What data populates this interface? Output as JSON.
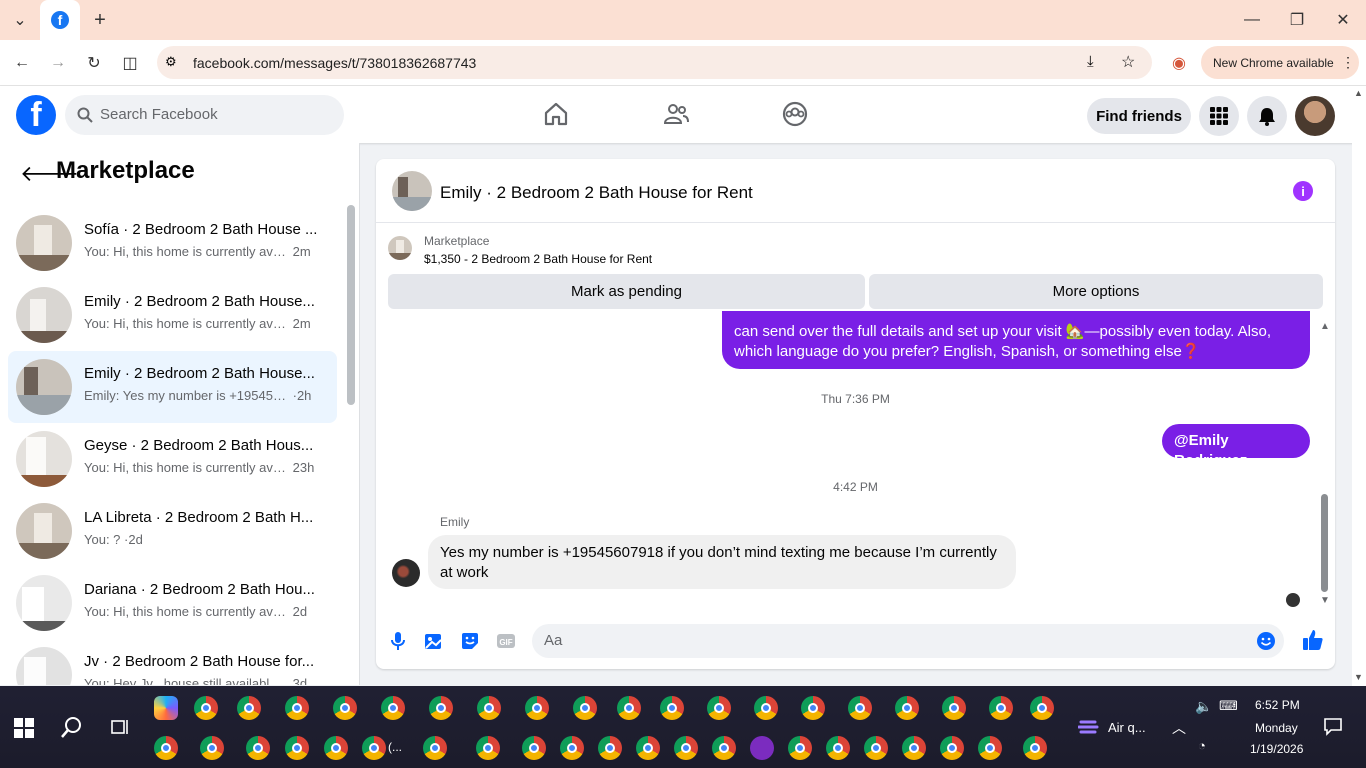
{
  "browser": {
    "url": "facebook.com/messages/t/738018362687743",
    "new_chrome_label": "New Chrome available"
  },
  "fb_header": {
    "search_placeholder": "Search Facebook",
    "find_friends_label": "Find friends"
  },
  "sidebar": {
    "title": "Marketplace",
    "conversations": [
      {
        "name": "Sofía · 2 Bedroom 2 Bath House ...",
        "snippet": "You: Hi, this home is currently avail...",
        "time": "2m",
        "active": false
      },
      {
        "name": "Emily · 2 Bedroom 2 Bath House...",
        "snippet": "You: Hi, this home is currently avail...",
        "time": "2m",
        "active": false
      },
      {
        "name": "Emily · 2 Bedroom 2 Bath House...",
        "snippet": "Emily: Yes my number is +1954560...",
        "time": "·2h",
        "active": true
      },
      {
        "name": "Geyse · 2 Bedroom 2 Bath Hous...",
        "snippet": "You: Hi, this home is currently avai...",
        "time": "23h",
        "active": false
      },
      {
        "name": "LA Libreta · 2 Bedroom 2 Bath H...",
        "snippet": "You: ? ·",
        "time": "2d",
        "active": false
      },
      {
        "name": "Dariana · 2 Bedroom 2 Bath Hou...",
        "snippet": "You: Hi, this home is currently avail...",
        "time": "2d",
        "active": false
      },
      {
        "name": "Jv · 2 Bedroom 2 Bath House for...",
        "snippet": "You: Hey Jv , house still available! ...",
        "time": "3d",
        "active": false
      }
    ]
  },
  "chat": {
    "title": "Emily · 2 Bedroom 2 Bath House for Rent",
    "marketplace_label": "Marketplace",
    "listing": "$1,350 - 2 Bedroom 2 Bath House for Rent",
    "mark_pending_label": "Mark as pending",
    "more_options_label": "More options",
    "messages": {
      "outgoing_1_line1": "can send over the full details and set up your visit 🏡—possibly even today. Also,",
      "outgoing_1_line2": "which language do you prefer? English, Spanish, or something else❓",
      "timestamp_1": "Thu 7:36 PM",
      "outgoing_2": "@Emily Rodriguez",
      "timestamp_2": "4:42 PM",
      "sender_name": "Emily",
      "incoming_1": "Yes my number is +19545607918 if you don’t mind texting me because I’m currently at work"
    },
    "composer_placeholder": "Aa"
  },
  "taskbar": {
    "weather_label": "Air q...",
    "time": "6:52 PM",
    "day": "Monday",
    "date": "1/19/2026",
    "ellipsis_label": "(..."
  },
  "colors": {
    "fb_blue": "#0866ff",
    "messenger_purple": "#7a1fe6",
    "chrome_frame": "#fbe0d3"
  }
}
